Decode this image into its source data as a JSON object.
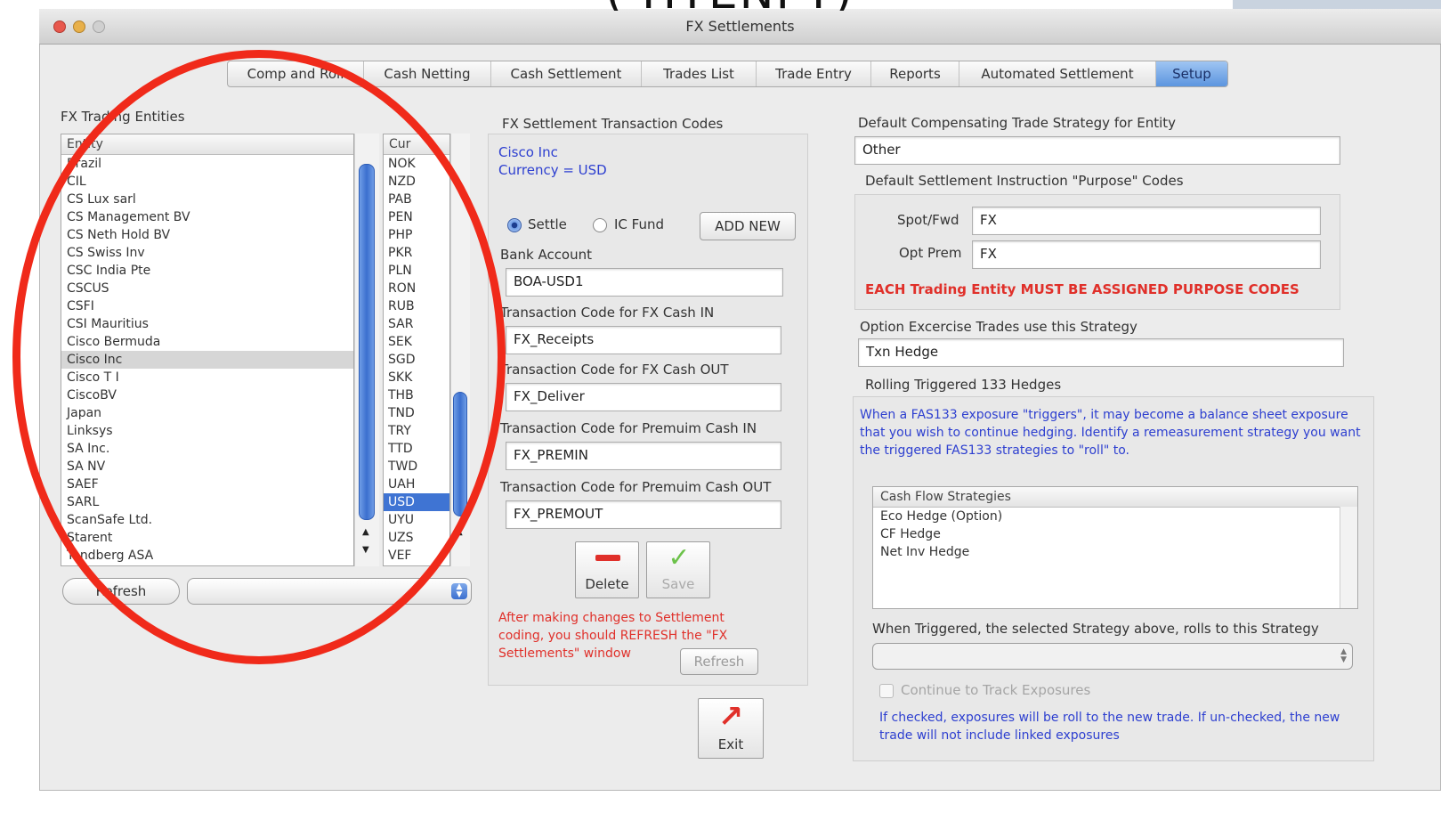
{
  "window": {
    "title": "FX Settlements",
    "overlay_text": "(  HTENPY)"
  },
  "tabs": [
    {
      "label": "Comp and Roll"
    },
    {
      "label": "Cash Netting"
    },
    {
      "label": "Cash Settlement"
    },
    {
      "label": "Trades List"
    },
    {
      "label": "Trade Entry"
    },
    {
      "label": "Reports"
    },
    {
      "label": "Automated Settlement"
    },
    {
      "label": "Setup"
    }
  ],
  "entities": {
    "section_label": "FX Trading Entities",
    "col_entity": "Entity",
    "col_cur": "Cur",
    "rows": [
      {
        "name": "Brazil",
        "cur": "NOK"
      },
      {
        "name": "CIL",
        "cur": "NZD"
      },
      {
        "name": "CS Lux sarl",
        "cur": "PAB"
      },
      {
        "name": "CS Management BV",
        "cur": "PEN"
      },
      {
        "name": "CS Neth Hold BV",
        "cur": "PHP"
      },
      {
        "name": "CS Swiss Inv",
        "cur": "PKR"
      },
      {
        "name": "CSC India Pte",
        "cur": "PLN"
      },
      {
        "name": "CSCUS",
        "cur": "RON"
      },
      {
        "name": "CSFI",
        "cur": "RUB"
      },
      {
        "name": "CSI Mauritius",
        "cur": "SAR"
      },
      {
        "name": "Cisco Bermuda",
        "cur": "SEK"
      },
      {
        "name": "Cisco Inc",
        "cur": "SGD"
      },
      {
        "name": "Cisco T I",
        "cur": "SKK"
      },
      {
        "name": "CiscoBV",
        "cur": "THB"
      },
      {
        "name": "Japan",
        "cur": "TND"
      },
      {
        "name": "Linksys",
        "cur": "TRY"
      },
      {
        "name": "SA Inc.",
        "cur": "TTD"
      },
      {
        "name": "SA NV",
        "cur": "TWD"
      },
      {
        "name": "SAEF",
        "cur": "UAH"
      },
      {
        "name": "SARL",
        "cur": "USD"
      },
      {
        "name": "ScanSafe Ltd.",
        "cur": "UYU"
      },
      {
        "name": "Starent",
        "cur": "UZS"
      },
      {
        "name": "Tandberg ASA",
        "cur": "VEF"
      }
    ],
    "refresh_label": "Refresh",
    "selected_entity": "Cisco Inc",
    "selected_cur": "USD"
  },
  "txn": {
    "section_label": "FX Settlement Transaction Codes",
    "entity_line": "Cisco Inc",
    "currency_line": "Currency = USD",
    "radio_settle": "Settle",
    "radio_ic_fund": "IC Fund",
    "add_new_label": "ADD NEW",
    "bank_label": "Bank Account",
    "bank_value": "BOA-USD1",
    "cash_in_label": "Transaction Code for FX Cash IN",
    "cash_in_value": "FX_Receipts",
    "cash_out_label": "Transaction Code for FX Cash OUT",
    "cash_out_value": "FX_Deliver",
    "prem_in_label": "Transaction Code for Premuim Cash IN",
    "prem_in_value": "FX_PREMIN",
    "prem_out_label": "Transaction Code for Premuim Cash OUT",
    "prem_out_value": "FX_PREMOUT",
    "delete_label": "Delete",
    "save_label": "Save",
    "note": "After making changes to Settlement coding, you should REFRESH the \"FX Settlements\" window",
    "refresh_label": "Refresh",
    "exit_label": "Exit"
  },
  "right": {
    "default_strategy_label": "Default Compensating Trade Strategy for Entity",
    "default_strategy_value": "Other",
    "purpose_label": "Default Settlement Instruction \"Purpose\" Codes",
    "spot_label": "Spot/Fwd",
    "spot_value": "FX",
    "opt_label": "Opt Prem",
    "opt_value": "FX",
    "purpose_warning": "EACH Trading Entity MUST BE ASSIGNED PURPOSE CODES",
    "option_label": "Option Excercise Trades use this Strategy",
    "option_value": "Txn Hedge",
    "rolling_label": "Rolling Triggered 133 Hedges",
    "rolling_text": "When a FAS133 exposure \"triggers\", it may become a balance sheet exposure that you wish to continue hedging.  Identify a remeasurement strategy you want the triggered FAS133 strategies to \"roll\" to.",
    "cf_header": "Cash Flow Strategies",
    "cf_items": [
      "Eco Hedge (Option)",
      "CF Hedge",
      "Net Inv Hedge"
    ],
    "triggered_label": "When Triggered, the selected Strategy above, rolls to this Strategy",
    "continue_label": "Continue to Track Exposures",
    "continue_note": "If checked, exposures will be roll to the new trade.  If un-checked, the new trade will not include linked exposures"
  },
  "colors": {
    "accent": "#3f74d3",
    "annotation": "#f02a1a",
    "warning": "#e0302a",
    "info": "#2d3fd0"
  }
}
